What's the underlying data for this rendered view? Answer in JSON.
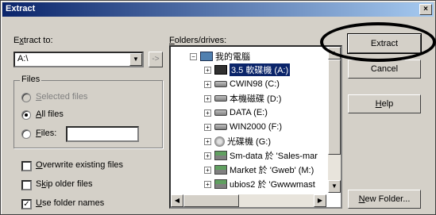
{
  "window": {
    "title": "Extract",
    "close_label": "×"
  },
  "extract_to": {
    "label_prefix": "E",
    "label_u": "x",
    "label_rest": "tract to:",
    "value": "A:\\",
    "browse_label": "->"
  },
  "files_group": {
    "title": "Files",
    "options": [
      {
        "u": "S",
        "rest": "elected files",
        "checked": false,
        "disabled": true
      },
      {
        "u": "A",
        "rest": "ll files",
        "checked": true,
        "disabled": false
      },
      {
        "u": "F",
        "rest": "iles:",
        "checked": false,
        "disabled": false
      }
    ],
    "files_value": ""
  },
  "checkboxes": [
    {
      "u": "O",
      "rest": "verwrite existing files",
      "checked": false
    },
    {
      "pre": "S",
      "u": "k",
      "rest": "ip older files",
      "checked": false
    },
    {
      "u": "U",
      "rest": "se folder names",
      "checked": true
    }
  ],
  "folders": {
    "label_u": "F",
    "label_rest": "olders/drives:",
    "items": [
      {
        "text": "我的電腦",
        "icon": "computer-icon",
        "level": 0
      },
      {
        "text": "3.5 軟碟機 (A:)",
        "icon": "floppy-icon",
        "level": 1,
        "selected": true
      },
      {
        "text": "CWIN98 (C:)",
        "icon": "drive-icon",
        "level": 1
      },
      {
        "text": "本機磁碟 (D:)",
        "icon": "drive-icon",
        "level": 1
      },
      {
        "text": "DATA (E:)",
        "icon": "drive-icon",
        "level": 1
      },
      {
        "text": "WIN2000 (F:)",
        "icon": "drive-icon",
        "level": 1
      },
      {
        "text": "光碟機 (G:)",
        "icon": "cdrom-icon",
        "level": 1
      },
      {
        "text": "Sm-data 於 'Sales-mar",
        "icon": "network-drive-icon",
        "level": 1
      },
      {
        "text": "Market 於 'Gweb' (M:)",
        "icon": "network-drive-icon",
        "level": 1
      },
      {
        "text": "ubios2 於 'Gwwwmast",
        "icon": "network-drive-icon",
        "level": 1
      }
    ]
  },
  "buttons": {
    "extract": "Extract",
    "cancel": "Cancel",
    "help_u": "H",
    "help_rest": "elp",
    "new_folder_u": "N",
    "new_folder_rest": "ew Folder..."
  }
}
